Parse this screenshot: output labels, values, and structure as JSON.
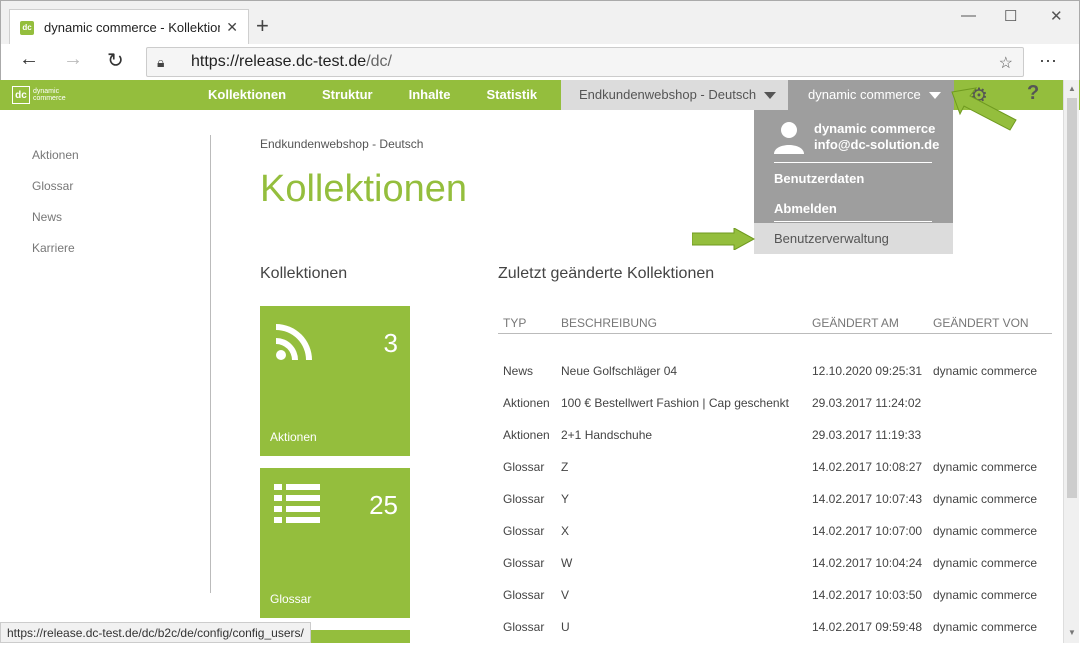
{
  "browser": {
    "tab_title": "dynamic commerce - Kollektione",
    "url_host": "https://release.dc-test.de",
    "url_path": "/dc/",
    "status_url": "https://release.dc-test.de/dc/b2c/de/config/config_users/"
  },
  "appbar": {
    "logo_text_line1": "dynamic",
    "logo_text_line2": "commerce",
    "nav": [
      "Kollektionen",
      "Struktur",
      "Inhalte",
      "Statistik"
    ],
    "shop_label": "Endkundenwebshop - Deutsch",
    "user_label": "dynamic commerce"
  },
  "sidebar": [
    "Aktionen",
    "Glossar",
    "News",
    "Karriere"
  ],
  "main": {
    "breadcrumb": "Endkundenwebshop - Deutsch",
    "title": "Kollektionen",
    "left_heading": "Kollektionen",
    "right_heading": "Zuletzt geänderte Kollektionen"
  },
  "tiles": [
    {
      "count": "3",
      "label": "Aktionen",
      "icon": "rss-icon"
    },
    {
      "count": "25",
      "label": "Glossar",
      "icon": "list-icon"
    }
  ],
  "table": {
    "headers": [
      "TYP",
      "BESCHREIBUNG",
      "GEÄNDERT AM",
      "GEÄNDERT VON"
    ],
    "rows": [
      [
        "News",
        "Neue Golfschläger 04",
        "12.10.2020 09:25:31",
        "dynamic commerce"
      ],
      [
        "Aktionen",
        "100 € Bestellwert Fashion | Cap geschenkt",
        "29.03.2017 11:24:02",
        ""
      ],
      [
        "Aktionen",
        "2+1 Handschuhe",
        "29.03.2017 11:19:33",
        ""
      ],
      [
        "Glossar",
        "Z",
        "14.02.2017 10:08:27",
        "dynamic commerce"
      ],
      [
        "Glossar",
        "Y",
        "14.02.2017 10:07:43",
        "dynamic commerce"
      ],
      [
        "Glossar",
        "X",
        "14.02.2017 10:07:00",
        "dynamic commerce"
      ],
      [
        "Glossar",
        "W",
        "14.02.2017 10:04:24",
        "dynamic commerce"
      ],
      [
        "Glossar",
        "V",
        "14.02.2017 10:03:50",
        "dynamic commerce"
      ],
      [
        "Glossar",
        "U",
        "14.02.2017 09:59:48",
        "dynamic commerce"
      ]
    ]
  },
  "user_menu": {
    "name": "dynamic commerce",
    "email": "info@dc-solution.de",
    "items": [
      "Benutzerdaten",
      "Abmelden"
    ],
    "highlighted_item": "Benutzerverwaltung"
  },
  "colors": {
    "accent": "#94be3d",
    "menu_gray": "#9e9e9e",
    "light_gray": "#dcdcdc"
  }
}
